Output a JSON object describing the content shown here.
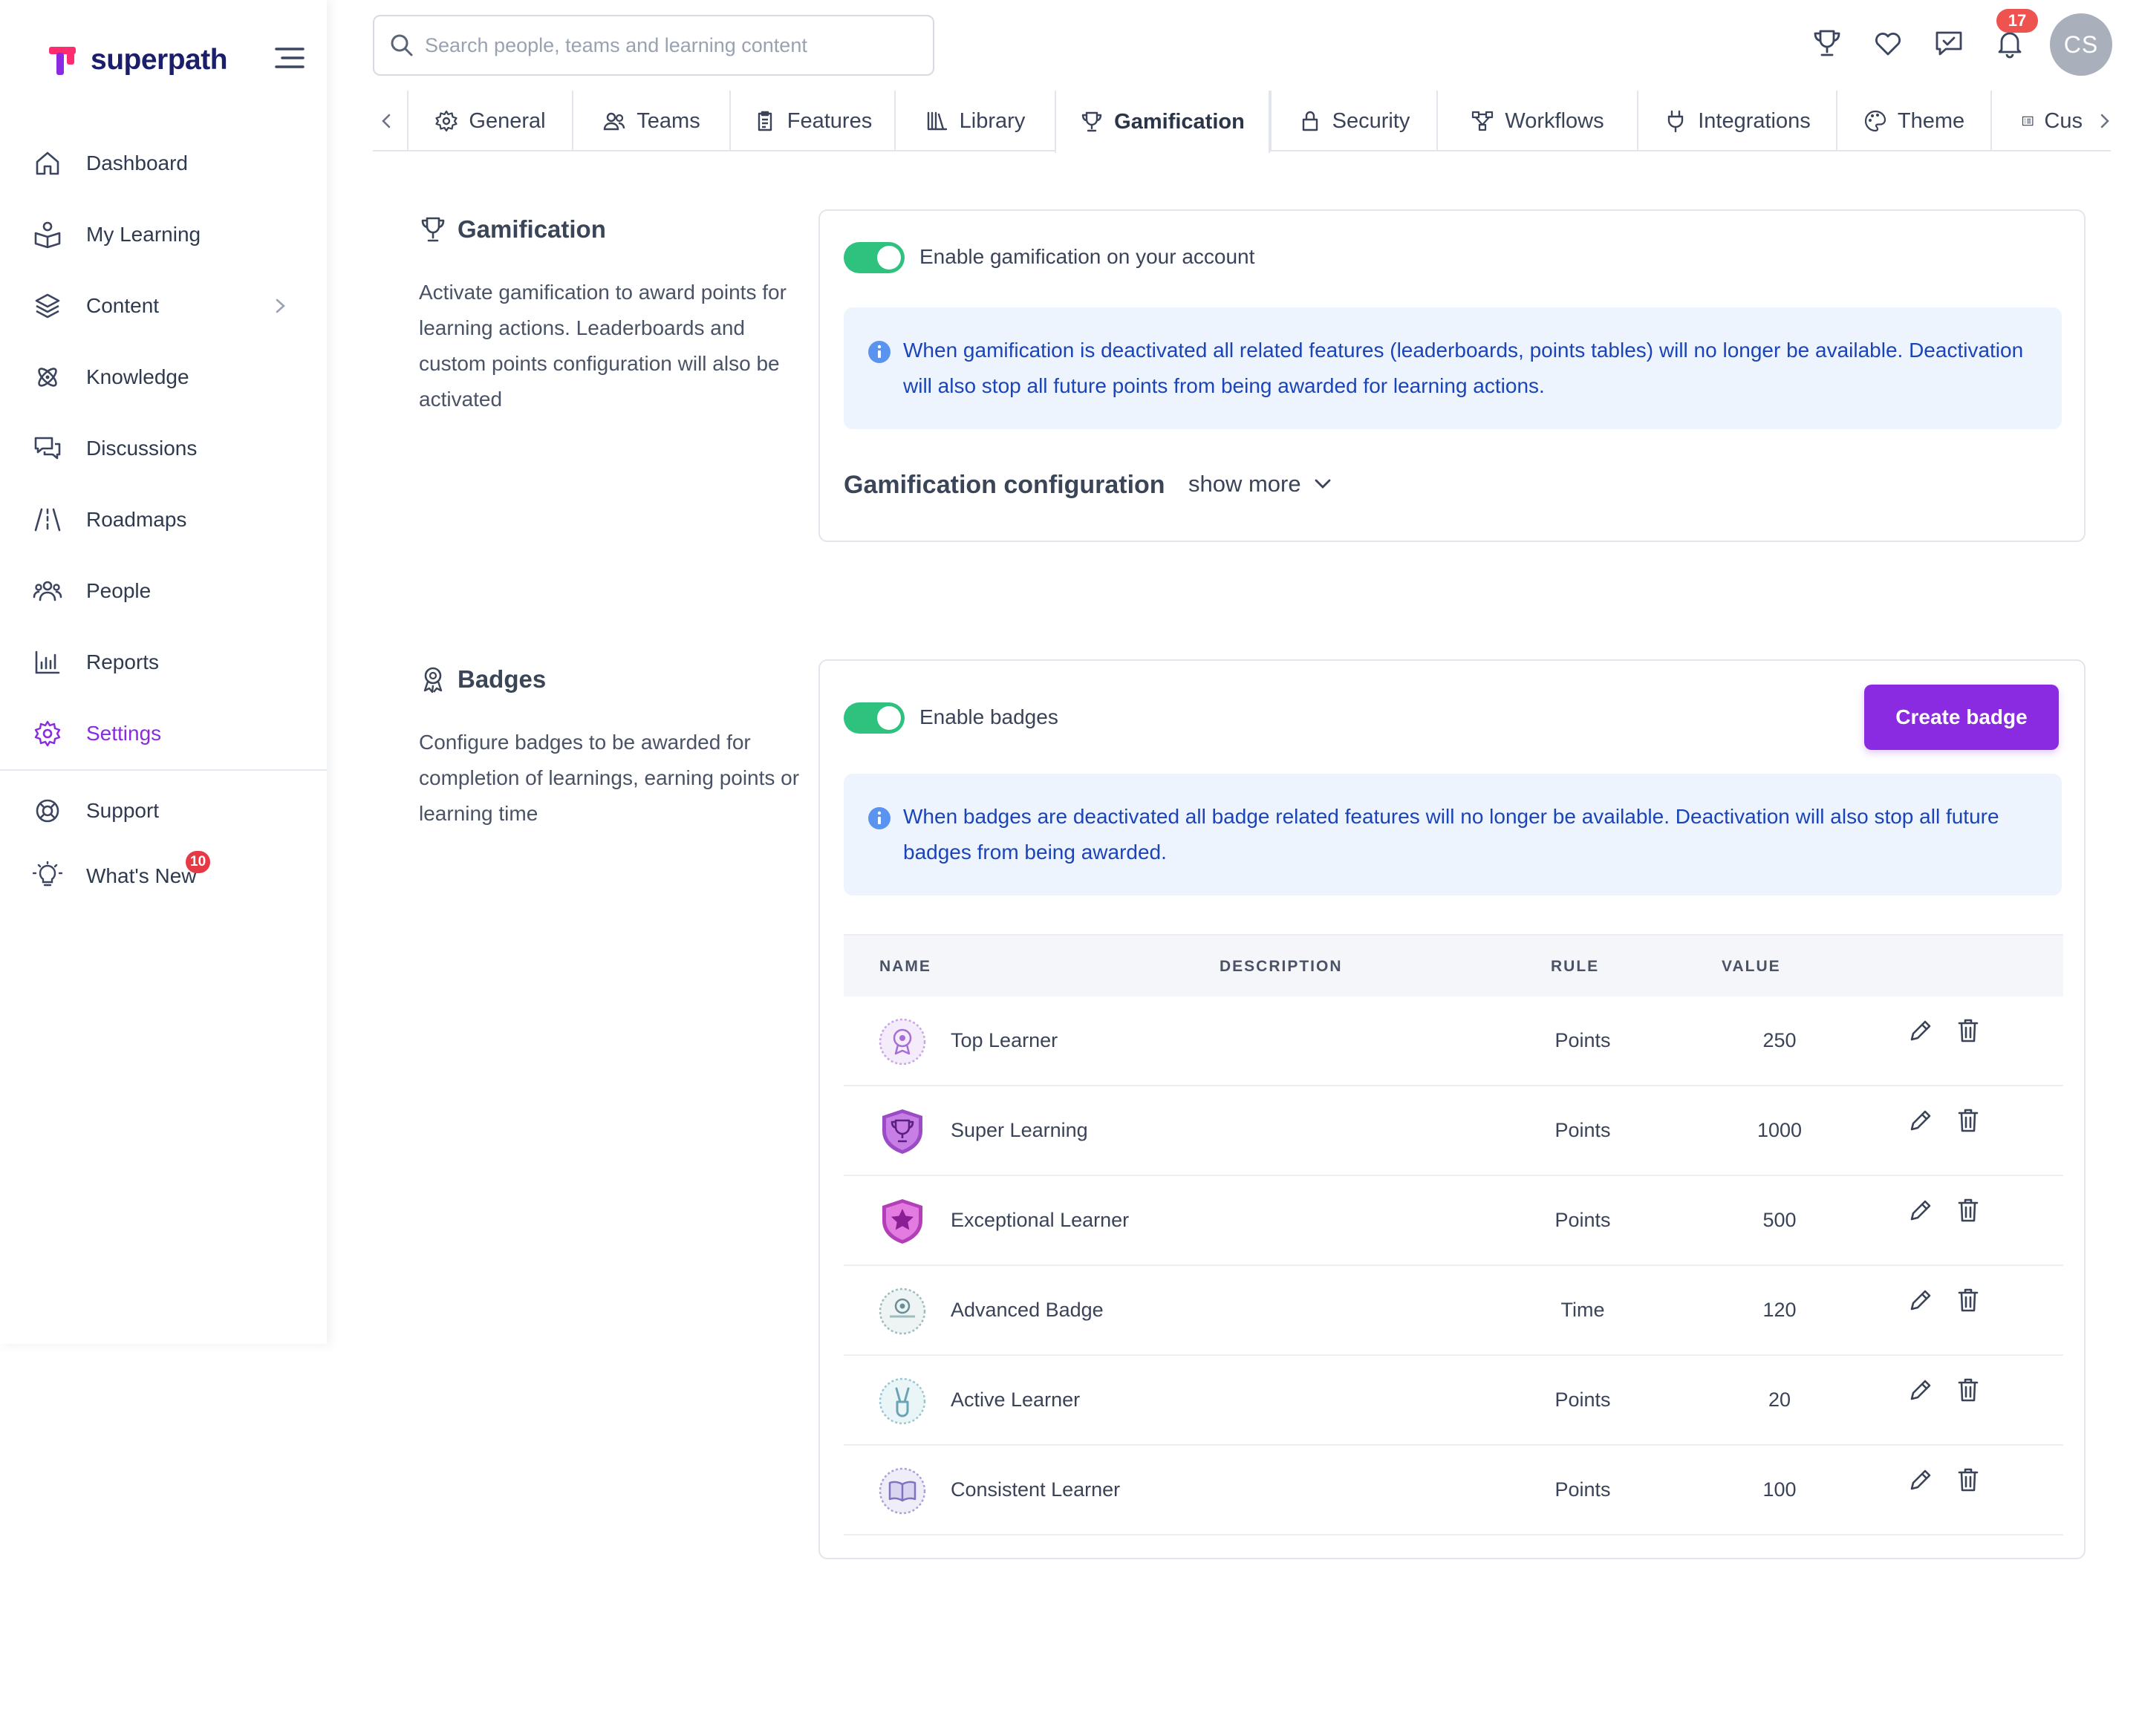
{
  "brand": {
    "name": "superpath"
  },
  "sidebar": {
    "items": [
      {
        "label": "Dashboard",
        "icon": "home-icon"
      },
      {
        "label": "My Learning",
        "icon": "book-reader-icon"
      },
      {
        "label": "Content",
        "icon": "layers-icon"
      },
      {
        "label": "Knowledge",
        "icon": "atom-icon"
      },
      {
        "label": "Discussions",
        "icon": "chat-bubbles-icon"
      },
      {
        "label": "Roadmaps",
        "icon": "road-icon"
      },
      {
        "label": "People",
        "icon": "people-icon"
      },
      {
        "label": "Reports",
        "icon": "bar-chart-icon"
      },
      {
        "label": "Settings",
        "icon": "gear-icon"
      }
    ],
    "secondary": [
      {
        "label": "Support",
        "icon": "lifebuoy-icon"
      },
      {
        "label": "What's New",
        "icon": "lightbulb-icon",
        "badge": "10"
      }
    ]
  },
  "search": {
    "placeholder": "Search people, teams and learning content",
    "value": ""
  },
  "header": {
    "notification_count": "17",
    "avatar_initials": "CS"
  },
  "tabs": [
    {
      "label": "General",
      "icon": "gear-icon"
    },
    {
      "label": "Teams",
      "icon": "people-icon"
    },
    {
      "label": "Features",
      "icon": "clipboard-icon"
    },
    {
      "label": "Library",
      "icon": "library-icon"
    },
    {
      "label": "Gamification",
      "icon": "trophy-icon",
      "active": true
    },
    {
      "label": "Security",
      "icon": "lock-icon"
    },
    {
      "label": "Workflows",
      "icon": "workflow-icon"
    },
    {
      "label": "Integrations",
      "icon": "plug-icon"
    },
    {
      "label": "Theme",
      "icon": "palette-icon"
    },
    {
      "label": "Cus",
      "icon": "list-icon"
    }
  ],
  "gamification": {
    "title": "Gamification",
    "description": "Activate gamification to award points for learning actions. Leaderboards and custom points configuration will also be activated",
    "toggle_label": "Enable gamification on your account",
    "enabled": true,
    "info": "When gamification is deactivated all related features (leaderboards, points tables) will no longer be available. Deactivation will also stop all future points from being awarded for learning actions.",
    "config_title": "Gamification configuration",
    "show_more": "show more"
  },
  "badges": {
    "title": "Badges",
    "description": "Configure badges to be awarded for completion of learnings, earning points or learning time",
    "toggle_label": "Enable badges",
    "enabled": true,
    "create_button": "Create badge",
    "info": "When badges are deactivated all badge related features will no longer be available. Deactivation will also stop all future badges from being awarded.",
    "columns": {
      "name": "NAME",
      "description": "DESCRIPTION",
      "rule": "RULE",
      "value": "VALUE"
    },
    "rows": [
      {
        "name": "Top Learner",
        "description": "",
        "rule": "Points",
        "value": "250",
        "icon": "award-ribbon-badge"
      },
      {
        "name": "Super Learning",
        "description": "",
        "rule": "Points",
        "value": "1000",
        "icon": "trophy-shield-badge"
      },
      {
        "name": "Exceptional Learner",
        "description": "",
        "rule": "Points",
        "value": "500",
        "icon": "star-shield-badge"
      },
      {
        "name": "Advanced Badge",
        "description": "",
        "rule": "Time",
        "value": "120",
        "icon": "target-circle-badge"
      },
      {
        "name": "Active Learner",
        "description": "",
        "rule": "Points",
        "value": "20",
        "icon": "victory-hand-badge"
      },
      {
        "name": "Consistent Learner",
        "description": "",
        "rule": "Points",
        "value": "100",
        "icon": "book-circle-badge"
      }
    ]
  },
  "colors": {
    "accent": "#8a2be2",
    "toggle_on": "#2ec27e",
    "info_bg": "#eef4fe",
    "info_text": "#1a44b8",
    "badge_red": "#e63946"
  }
}
